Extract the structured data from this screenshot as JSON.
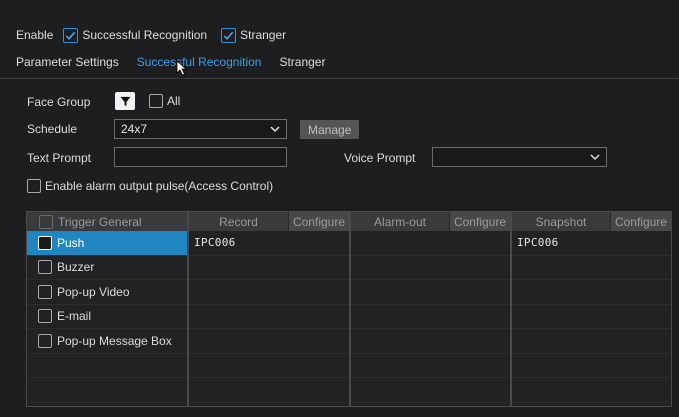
{
  "enable_row": {
    "enable_label": "Enable",
    "successful_label": "Successful Recognition",
    "stranger_label": "Stranger"
  },
  "tabs": [
    {
      "label": "Parameter Settings"
    },
    {
      "label": "Successful Recognition"
    },
    {
      "label": "Stranger"
    }
  ],
  "form": {
    "face_group_label": "Face Group",
    "all_label": "All",
    "schedule_label": "Schedule",
    "schedule_value": "24x7",
    "manage_label": "Manage",
    "text_prompt_label": "Text Prompt",
    "text_prompt_value": "",
    "voice_prompt_label": "Voice Prompt",
    "voice_prompt_value": "",
    "alarm_pulse_label": "Enable alarm output pulse(Access Control)"
  },
  "trigger_table": {
    "header": "Trigger General",
    "rows": [
      {
        "label": "Push"
      },
      {
        "label": "Buzzer"
      },
      {
        "label": "Pop-up Video"
      },
      {
        "label": "E-mail"
      },
      {
        "label": "Pop-up Message Box"
      }
    ]
  },
  "record_table": {
    "header": "Record",
    "configure": "Configure",
    "rows": [
      "IPC006"
    ]
  },
  "alarm_table": {
    "header": "Alarm-out",
    "configure": "Configure",
    "rows": []
  },
  "snapshot_table": {
    "header": "Snapshot",
    "configure": "Configure",
    "rows": [
      "IPC006"
    ]
  },
  "colors": {
    "accent": "#1f86c2",
    "tab_active": "#3aa0e6",
    "background": "#1e1e20"
  }
}
